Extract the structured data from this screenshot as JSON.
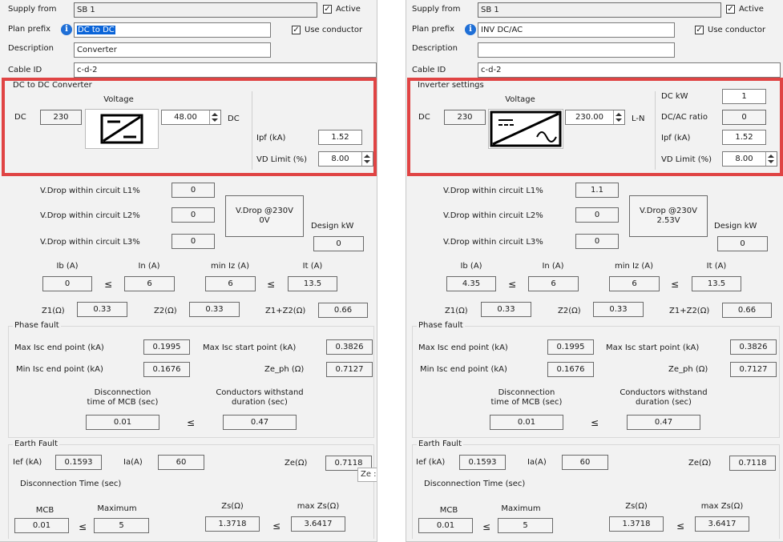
{
  "left": {
    "supply_from": {
      "label": "Supply from",
      "value": "SB 1"
    },
    "active": {
      "label": "Active",
      "checked": true
    },
    "plan_prefix": {
      "label": "Plan prefix",
      "value": "DC to DC"
    },
    "use_conductor": {
      "label": "Use conductor",
      "checked": true
    },
    "description": {
      "label": "Description",
      "value": "Converter"
    },
    "cable_id": {
      "label": "Cable ID",
      "value": "c-d-2"
    },
    "converter": {
      "title": "DC to DC Converter",
      "voltage_label": "Voltage",
      "dc_in_label": "DC",
      "dc_in_value": "230",
      "voltage_out": "48.00",
      "out_unit": "DC",
      "symbol": "dc-dc-converter-icon",
      "ipf_label": "Ipf (kA)",
      "ipf_value": "1.52",
      "vd_limit_label": "VD Limit (%)",
      "vd_limit_value": "8.00"
    },
    "vdrop": {
      "l1_label": "V.Drop within circuit L1%",
      "l1": "0",
      "l2_label": "V.Drop within circuit L2%",
      "l2": "0",
      "l3_label": "V.Drop within circuit L3%",
      "l3": "0",
      "at230_line1": "V.Drop @230V",
      "at230_line2": "0V",
      "design_kw_label": "Design kW",
      "design_kw": "0"
    },
    "currents": {
      "ib_label": "Ib (A)",
      "ib": "0",
      "in_label": "In (A)",
      "in": "6",
      "miniz_label": "min Iz (A)",
      "miniz": "6",
      "it_label": "It (A)",
      "it": "13.5",
      "le": "≤"
    },
    "impedance": {
      "z1_label": "Z1(Ω)",
      "z1": "0.33",
      "z2_label": "Z2(Ω)",
      "z2": "0.33",
      "z12_label": "Z1+Z2(Ω)",
      "z12": "0.66"
    },
    "phase_fault": {
      "title": "Phase fault",
      "max_isc_end_label": "Max Isc end point (kA)",
      "max_isc_end": "0.1995",
      "max_isc_start_label": "Max Isc start point (kA)",
      "max_isc_start": "0.3826",
      "min_isc_end_label": "Min Isc end point (kA)",
      "min_isc_end": "0.1676",
      "ze_ph_label": "Ze_ph (Ω)",
      "ze_ph": "0.7127",
      "disc_mcb_line1": "Disconnection",
      "disc_mcb_line2": "time of MCB (sec)",
      "disc_mcb": "0.01",
      "withstand_line1": "Conductors withstand",
      "withstand_line2": "duration (sec)",
      "withstand": "0.47"
    },
    "earth_fault": {
      "title": "Earth Fault",
      "ief_label": "Ief (kA)",
      "ief": "0.1593",
      "ia_label": "Ia(A)",
      "ia": "60",
      "ze_label": "Ze(Ω)",
      "ze": "0.7118",
      "disc_time_label": "Disconnection Time (sec)",
      "mcb_label": "MCB",
      "mcb": "0.01",
      "maximum_label": "Maximum",
      "maximum": "5",
      "zs_label": "Zs(Ω)",
      "zs": "1.3718",
      "max_zs_label": "max Zs(Ω)",
      "max_zs": "3.6417",
      "tooltip": "Ze :"
    }
  },
  "right": {
    "supply_from": {
      "label": "Supply from",
      "value": "SB 1"
    },
    "active": {
      "label": "Active",
      "checked": true
    },
    "plan_prefix": {
      "label": "Plan prefix",
      "value": "INV DC/AC"
    },
    "use_conductor": {
      "label": "Use conductor",
      "checked": true
    },
    "description": {
      "label": "Description",
      "value": ""
    },
    "cable_id": {
      "label": "Cable ID",
      "value": "c-d-2"
    },
    "inverter": {
      "title": "Inverter settings",
      "voltage_label": "Voltage",
      "dc_in_label": "DC",
      "dc_in_value": "230",
      "voltage_out": "230.00",
      "out_unit": "L-N",
      "symbol": "dc-ac-inverter-icon",
      "dc_kw_label": "DC kW",
      "dc_kw": "1",
      "ratio_label": "DC/AC ratio",
      "ratio": "0",
      "ipf_label": "Ipf (kA)",
      "ipf_value": "1.52",
      "vd_limit_label": "VD Limit (%)",
      "vd_limit_value": "8.00"
    },
    "vdrop": {
      "l1_label": "V.Drop within circuit L1%",
      "l1": "1.1",
      "l2_label": "V.Drop within circuit L2%",
      "l2": "0",
      "l3_label": "V.Drop within circuit L3%",
      "l3": "0",
      "at230_line1": "V.Drop @230V",
      "at230_line2": "2.53V",
      "design_kw_label": "Design kW",
      "design_kw": "0"
    },
    "currents": {
      "ib_label": "Ib (A)",
      "ib": "4.35",
      "in_label": "In (A)",
      "in": "6",
      "miniz_label": "min Iz (A)",
      "miniz": "6",
      "it_label": "It (A)",
      "it": "13.5",
      "le": "≤"
    },
    "impedance": {
      "z1_label": "Z1(Ω)",
      "z1": "0.33",
      "z2_label": "Z2(Ω)",
      "z2": "0.33",
      "z12_label": "Z1+Z2(Ω)",
      "z12": "0.66"
    },
    "phase_fault": {
      "title": "Phase fault",
      "max_isc_end_label": "Max Isc end point (kA)",
      "max_isc_end": "0.1995",
      "max_isc_start_label": "Max Isc start point (kA)",
      "max_isc_start": "0.3826",
      "min_isc_end_label": "Min Isc end point (kA)",
      "min_isc_end": "0.1676",
      "ze_ph_label": "Ze_ph (Ω)",
      "ze_ph": "0.7127",
      "disc_mcb_line1": "Disconnection",
      "disc_mcb_line2": "time of MCB (sec)",
      "disc_mcb": "0.01",
      "withstand_line1": "Conductors withstand",
      "withstand_line2": "duration (sec)",
      "withstand": "0.47"
    },
    "earth_fault": {
      "title": "Earth Fault",
      "ief_label": "Ief (kA)",
      "ief": "0.1593",
      "ia_label": "Ia(A)",
      "ia": "60",
      "ze_label": "Ze(Ω)",
      "ze": "0.7118",
      "disc_time_label": "Disconnection Time (sec)",
      "mcb_label": "MCB",
      "mcb": "0.01",
      "maximum_label": "Maximum",
      "maximum": "5",
      "zs_label": "Zs(Ω)",
      "zs": "1.3718",
      "max_zs_label": "max Zs(Ω)",
      "max_zs": "3.6417"
    }
  },
  "colors": {
    "highlight": "#e04444",
    "selection": "#0a64d8",
    "info_icon": "#1f6fd6"
  }
}
